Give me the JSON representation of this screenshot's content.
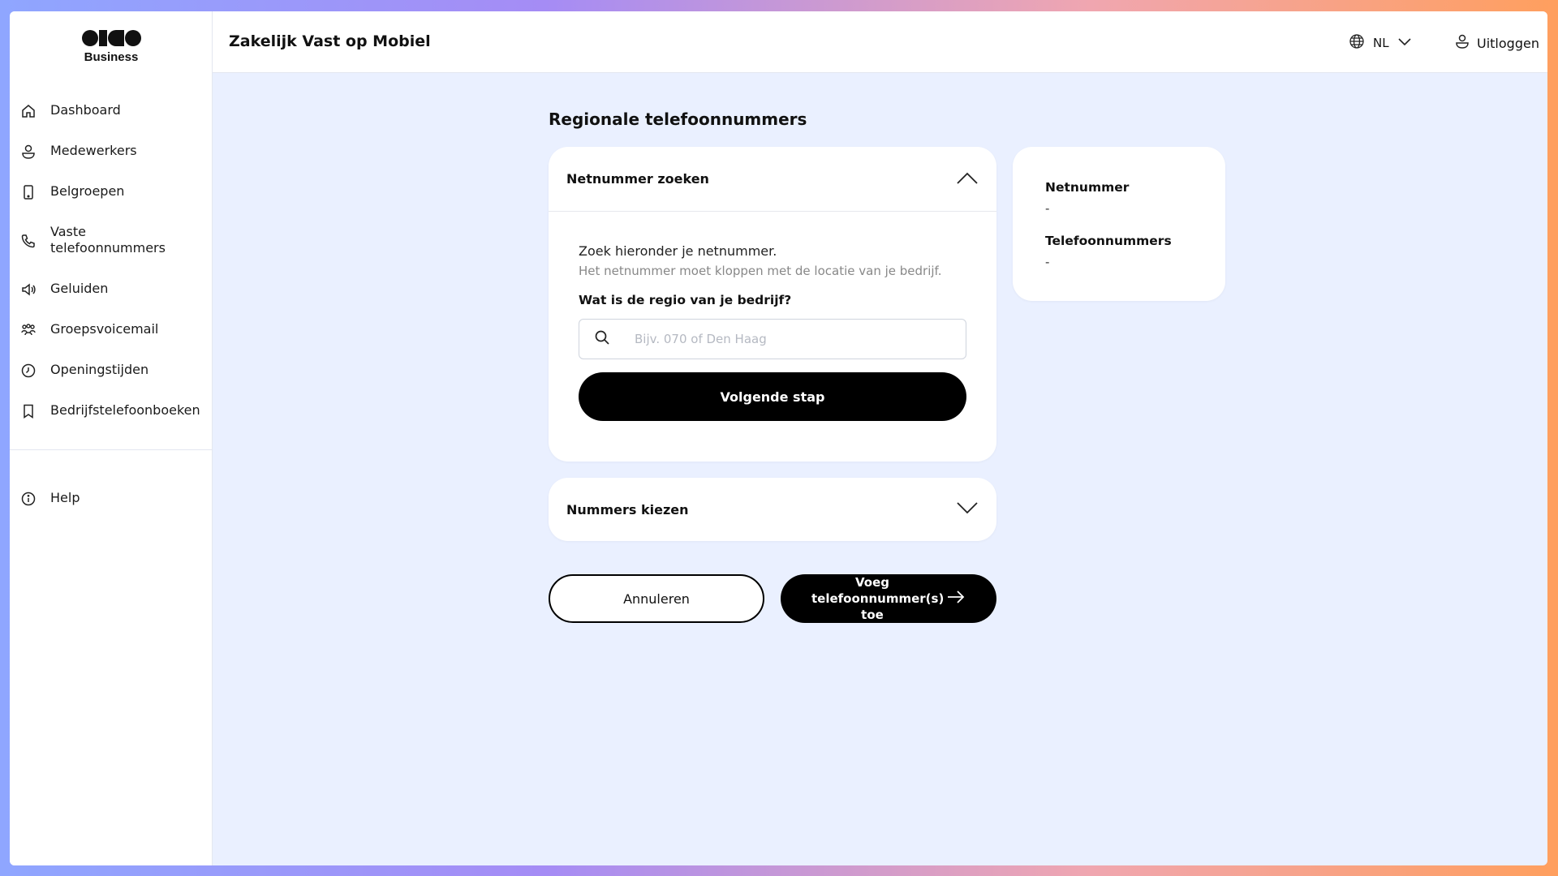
{
  "brand": {
    "name": "Business"
  },
  "header": {
    "title": "Zakelijk Vast op Mobiel",
    "language": "NL",
    "logout_label": "Uitloggen"
  },
  "sidebar": {
    "items": [
      {
        "label": "Dashboard",
        "icon": "home-icon"
      },
      {
        "label": "Medewerkers",
        "icon": "user-icon"
      },
      {
        "label": "Belgroepen",
        "icon": "mobile-icon"
      },
      {
        "label": "Vaste telefoonnummers",
        "icon": "phone-icon"
      },
      {
        "label": "Geluiden",
        "icon": "speaker-icon"
      },
      {
        "label": "Groepsvoicemail",
        "icon": "group-icon"
      },
      {
        "label": "Openingstijden",
        "icon": "clock-icon"
      },
      {
        "label": "Bedrijfstelefoonboeken",
        "icon": "bookmark-icon"
      }
    ],
    "help_label": "Help"
  },
  "main": {
    "page_title": "Regionale telefoonnummers",
    "search_card": {
      "title": "Netnummer zoeken",
      "hint_primary": "Zoek hieronder je netnummer.",
      "hint_secondary": "Het netnummer moet kloppen met de locatie van je bedrijf.",
      "question": "Wat is de regio van je bedrijf?",
      "search_placeholder": "Bijv. 070 of Den Haag",
      "search_value": "",
      "next_button": "Volgende stap"
    },
    "numbers_card": {
      "title": "Nummers kiezen"
    },
    "summary": {
      "netnummer_label": "Netnummer",
      "netnummer_value": "-",
      "telefoonnummers_label": "Telefoonnummers",
      "telefoonnummers_value": "-"
    },
    "cancel_button": "Annuleren",
    "add_button": "Voeg telefoonnummer(s) toe"
  }
}
